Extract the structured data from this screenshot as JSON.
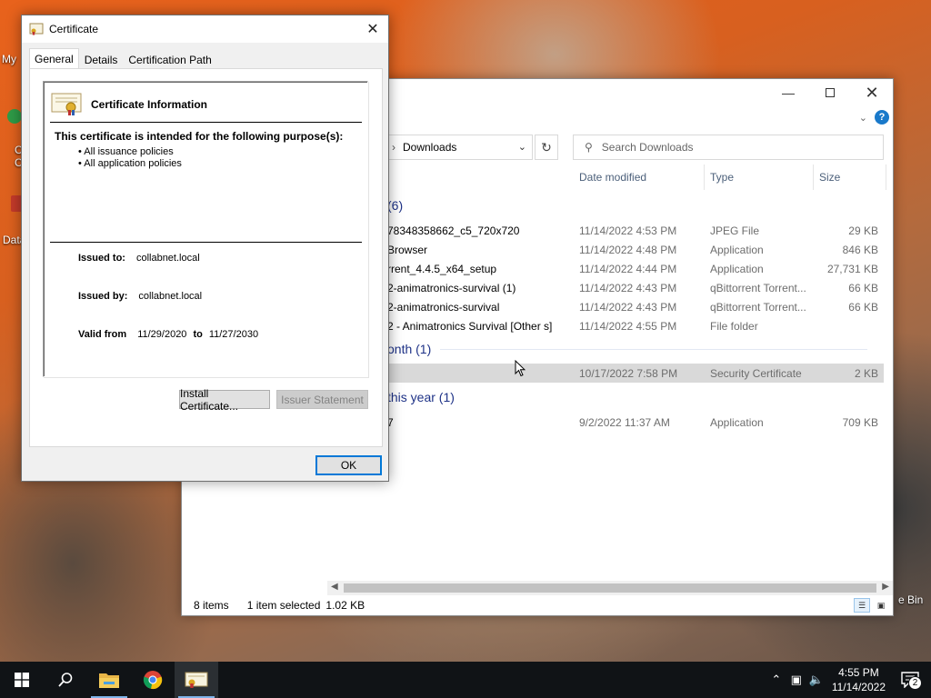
{
  "desktop": {
    "icons": [
      {
        "label": "My"
      },
      {
        "label": "C"
      },
      {
        "label": "C"
      },
      {
        "label": "Data"
      },
      {
        "label": "e Bin"
      }
    ]
  },
  "explorer": {
    "address": "Downloads",
    "search_placeholder": "Search Downloads",
    "columns": {
      "date": "Date modified",
      "type": "Type",
      "size": "Size"
    },
    "groups": [
      {
        "label": "(6)"
      },
      {
        "label": "onth (1)"
      },
      {
        "label": "this year (1)"
      }
    ],
    "rows": [
      {
        "name": "78348358662_c5_720x720",
        "date": "11/14/2022 4:53 PM",
        "type": "JPEG File",
        "size": "29 KB"
      },
      {
        "name": "Browser",
        "date": "11/14/2022 4:48 PM",
        "type": "Application",
        "size": "846 KB"
      },
      {
        "name": "rrent_4.4.5_x64_setup",
        "date": "11/14/2022 4:44 PM",
        "type": "Application",
        "size": "27,731 KB"
      },
      {
        "name": "2-animatronics-survival (1)",
        "date": "11/14/2022 4:43 PM",
        "type": "qBittorrent Torrent...",
        "size": "66 KB"
      },
      {
        "name": "2-animatronics-survival",
        "date": "11/14/2022 4:43 PM",
        "type": "qBittorrent Torrent...",
        "size": "66 KB"
      },
      {
        "name": "2 - Animatronics Survival [Other s]",
        "date": "11/14/2022 4:55 PM",
        "type": "File folder",
        "size": ""
      },
      {
        "name": "",
        "date": "10/17/2022 7:58 PM",
        "type": "Security Certificate",
        "size": "2 KB"
      },
      {
        "name": "7",
        "date": "9/2/2022 11:37 AM",
        "type": "Application",
        "size": "709 KB"
      }
    ],
    "status": {
      "items": "8 items",
      "selected": "1 item selected",
      "size": "1.02 KB"
    }
  },
  "certificate": {
    "title": "Certificate",
    "tabs": [
      "General",
      "Details",
      "Certification Path"
    ],
    "info_title": "Certificate Information",
    "purpose_heading": "This certificate is intended for the following purpose(s):",
    "purposes": [
      "• All issuance policies",
      "• All application policies"
    ],
    "issued_to_label": "Issued to:",
    "issued_to": "collabnet.local",
    "issued_by_label": "Issued by:",
    "issued_by": "collabnet.local",
    "valid_from_label": "Valid from",
    "valid_from": "11/29/2020",
    "to_label": "to",
    "valid_to": "11/27/2030",
    "install_button": "Install Certificate...",
    "issuer_statement_button": "Issuer Statement",
    "ok_button": "OK"
  },
  "taskbar": {
    "clock_time": "4:55 PM",
    "clock_date": "11/14/2022",
    "notification_count": "2"
  },
  "colors": {
    "accent": "#0078d7",
    "group_header": "#1e3287",
    "taskbar": "#101316"
  }
}
